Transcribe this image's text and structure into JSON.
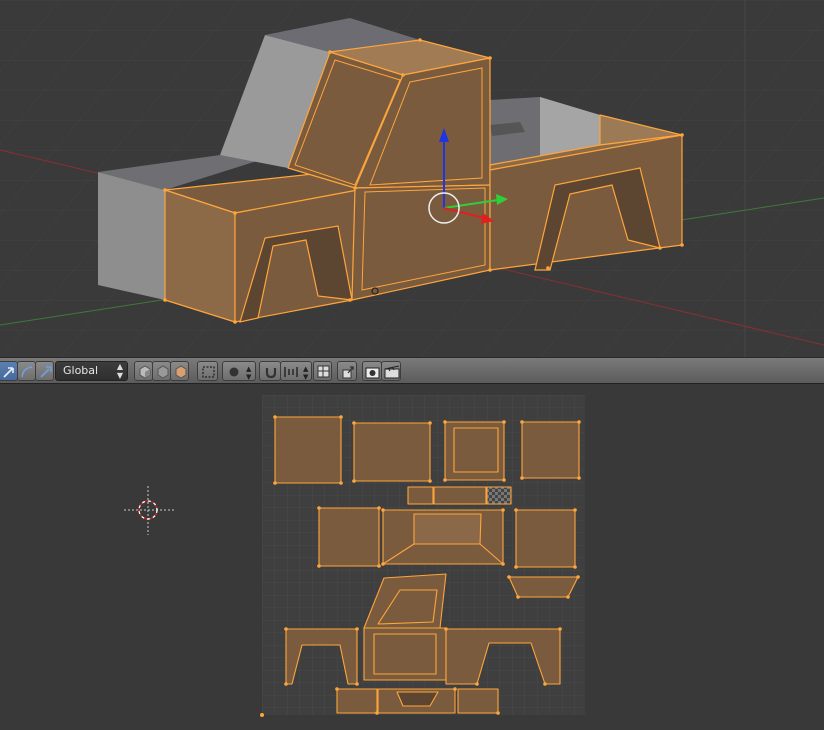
{
  "editor_header": {
    "transform_orientation": "Global"
  },
  "icons": {
    "manipulator_translate": "arrow-icon",
    "manipulator_rotate": "rotate-arc-icon",
    "manipulator_scale": "scale-icon",
    "shading_solid": "cube-solid-icon",
    "shading_texture": "cube-texture-icon",
    "shading_material": "cube-material-icon",
    "occlude": "box-select-icon",
    "pivot": "circle-icon",
    "snap": "magnet-icon",
    "snap_element": "snap-element-icon",
    "render_camera": "camera-icon",
    "render_clapper": "clapper-icon",
    "cursor_2d": "crosshair-cursor-icon"
  },
  "colors": {
    "selection_orange": "#ffa53d",
    "mesh_face_fill": "#7a5b3d",
    "mesh_unselected": "#a0a0a0",
    "x_axis": "#d03030",
    "y_axis": "#2ecc40",
    "z_axis": "#2a3fd0",
    "header_active": "#5680c2"
  }
}
